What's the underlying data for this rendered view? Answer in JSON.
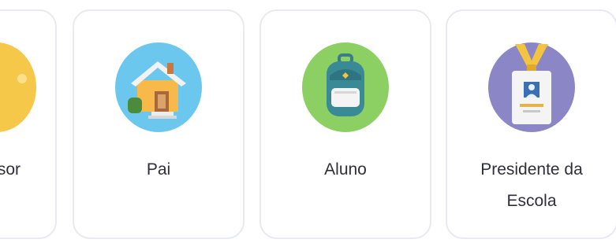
{
  "role_cards": [
    {
      "id": "professor",
      "label_lines": [
        "Professor"
      ],
      "icon": "teacher-icon"
    },
    {
      "id": "pai",
      "label_lines": [
        "Pai"
      ],
      "icon": "house-icon"
    },
    {
      "id": "aluno",
      "label_lines": [
        "Aluno"
      ],
      "icon": "backpack-icon"
    },
    {
      "id": "presidente",
      "label_lines": [
        "Presidente da",
        "Escola"
      ],
      "icon": "id-badge-icon"
    }
  ],
  "colors": {
    "card_border": "#e8e9f1",
    "text": "#2f2f3a",
    "professor_icon_bg": "#f6c84a",
    "pai_icon_bg": "#6cc7ef",
    "aluno_icon_bg": "#8ccf63",
    "presidente_icon_bg": "#8b86c6"
  }
}
